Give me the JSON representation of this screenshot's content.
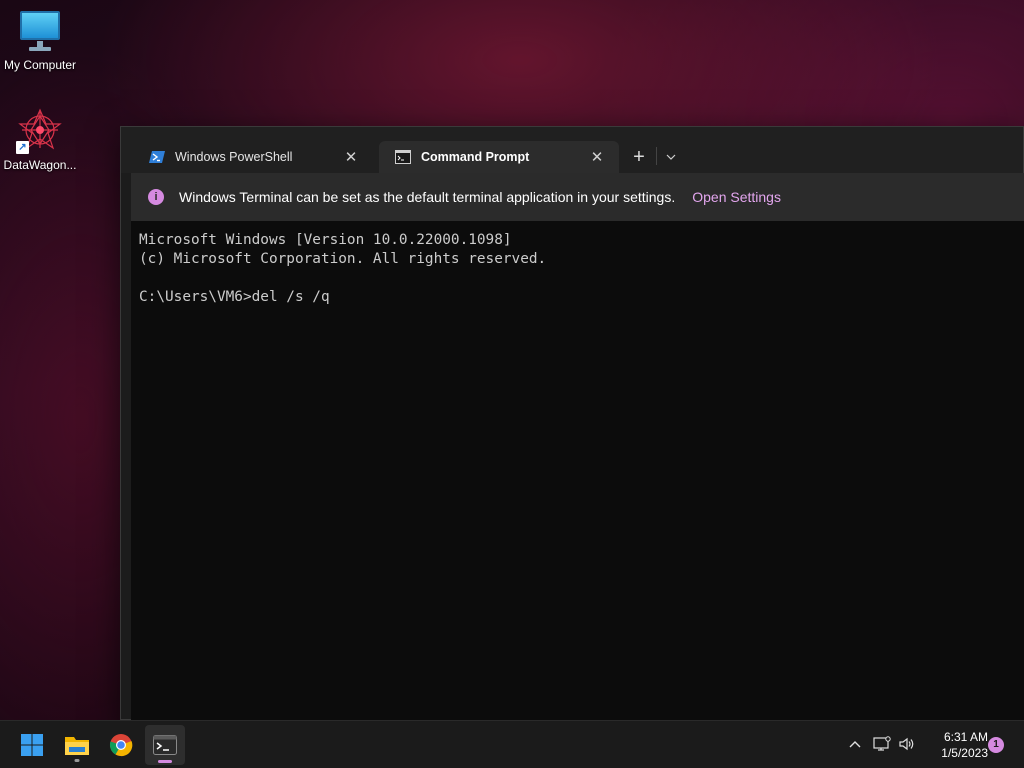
{
  "desktop": {
    "icons": [
      {
        "label": "My Computer",
        "icon": "monitor-icon"
      },
      {
        "label": "DataWagon...",
        "icon": "datawagon-icon"
      }
    ]
  },
  "terminal": {
    "tabs": [
      {
        "label": "Windows PowerShell",
        "icon": "powershell-icon",
        "active": false
      },
      {
        "label": "Command Prompt",
        "icon": "cmd-icon",
        "active": true
      }
    ],
    "new_tab_symbol": "+",
    "infobar": {
      "message": "Windows Terminal can be set as the default terminal application in your settings.",
      "link": "Open Settings"
    },
    "console": {
      "line1": "Microsoft Windows [Version 10.0.22000.1098]",
      "line2": "(c) Microsoft Corporation. All rights reserved.",
      "prompt": "C:\\Users\\VM6>del /s /q"
    }
  },
  "taskbar": {
    "apps": [
      "start-icon",
      "file-explorer-icon",
      "chrome-icon",
      "terminal-icon"
    ],
    "clock": {
      "time": "6:31 AM",
      "date": "1/5/2023"
    },
    "notification_count": "1"
  },
  "colors": {
    "accent": "#d58ae0",
    "console_bg": "#0c0c0c",
    "console_text": "#cccccc"
  }
}
